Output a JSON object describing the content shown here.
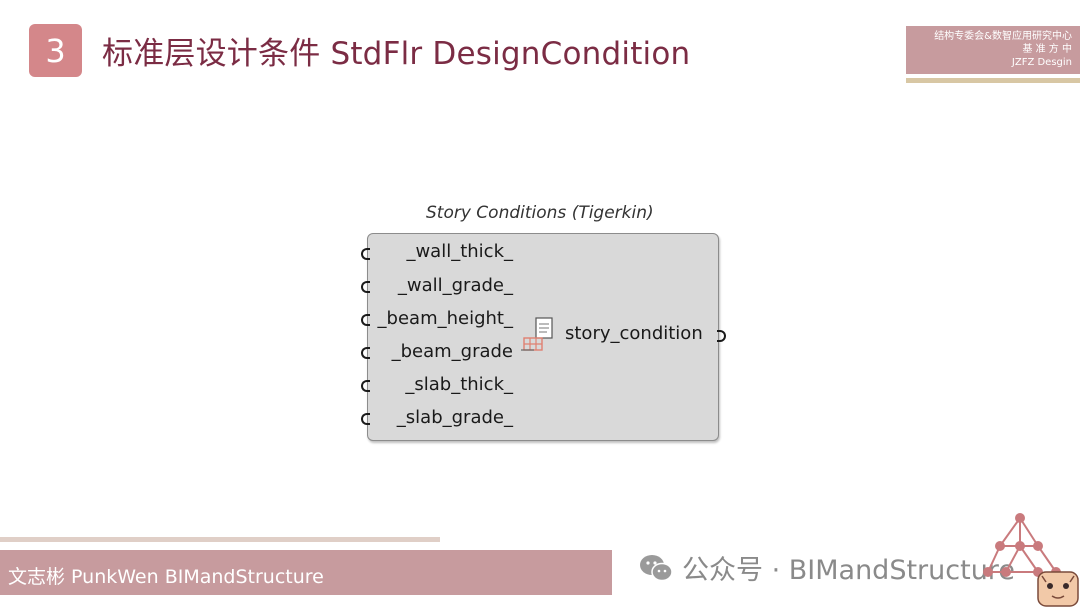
{
  "header": {
    "section_number": "3",
    "title": "标准层设计条件 StdFlr DesignCondition"
  },
  "corner_label": {
    "line1": "结构专委会&数智应用研究中心",
    "line2": "基 准 方 中",
    "line3": "JZFZ Desgin"
  },
  "component": {
    "caption": "Story Conditions (Tigerkin)",
    "inputs": [
      "_wall_thick_",
      "_wall_grade_",
      "_beam_height_",
      "_beam_grade",
      "_slab_thick_",
      "_slab_grade_"
    ],
    "output": "story_condition",
    "icon": "tigerkin-component-icon"
  },
  "footer": {
    "author": "文志彬 PunkWen BIMandStructure",
    "watermark": "公众号 · BIMandStructure"
  },
  "colors": {
    "accent": "#d4878a",
    "title": "#7b2c44",
    "bar": "#c79b9e"
  }
}
